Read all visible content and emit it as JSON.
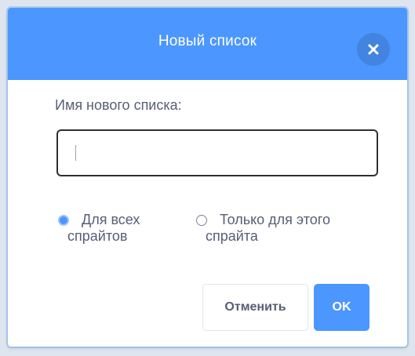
{
  "dialog": {
    "title": "Новый список",
    "close_icon": "close-icon",
    "field_label": "Имя нового списка:",
    "input": {
      "value": "",
      "placeholder": ""
    },
    "scope_options": [
      {
        "line1": "Для всех",
        "line2": "спрайтов",
        "checked": true
      },
      {
        "line1": "Только для этого",
        "line2": "спрайта",
        "checked": false
      }
    ],
    "cancel_label": "Отменить",
    "ok_label": "OK"
  },
  "colors": {
    "accent": "#4c97ff",
    "text": "#575e75",
    "white": "#ffffff"
  }
}
